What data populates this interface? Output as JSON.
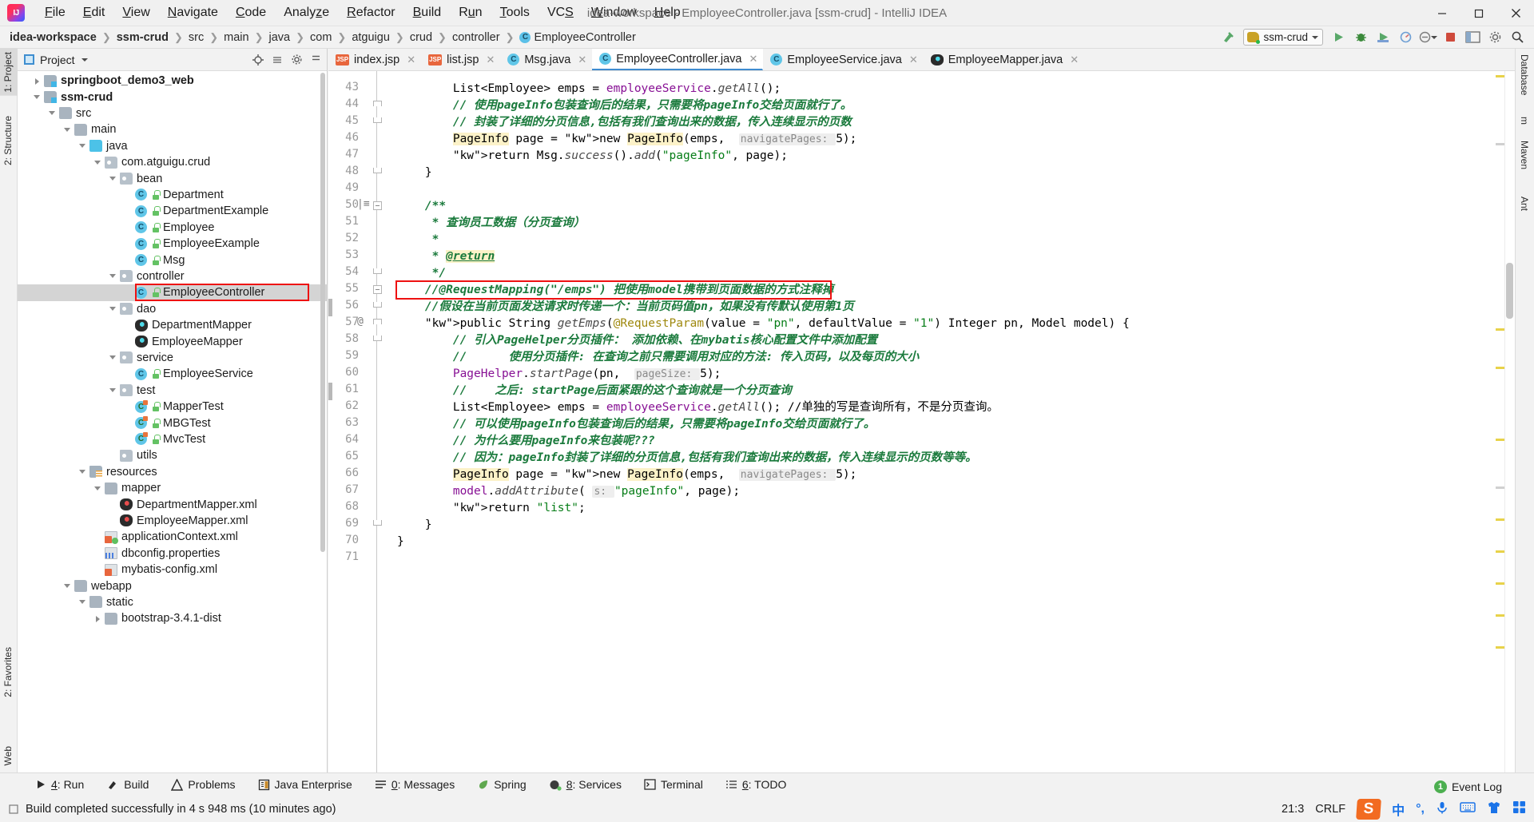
{
  "window": {
    "title": "idea-workspace - EmployeeController.java [ssm-crud] - IntelliJ IDEA",
    "app_icon": "intellij-idea-logo",
    "minimize": "–",
    "maximize": "❐",
    "close": "✕"
  },
  "menu": [
    {
      "label": "File",
      "mnemonic": "F"
    },
    {
      "label": "Edit",
      "mnemonic": "E"
    },
    {
      "label": "View",
      "mnemonic": "V"
    },
    {
      "label": "Navigate",
      "mnemonic": "N"
    },
    {
      "label": "Code",
      "mnemonic": "C"
    },
    {
      "label": "Analyze",
      "mnemonic": "z"
    },
    {
      "label": "Refactor",
      "mnemonic": "R"
    },
    {
      "label": "Build",
      "mnemonic": "B"
    },
    {
      "label": "Run",
      "mnemonic": "u"
    },
    {
      "label": "Tools",
      "mnemonic": "T"
    },
    {
      "label": "VCS",
      "mnemonic": "S"
    },
    {
      "label": "Window",
      "mnemonic": "W"
    },
    {
      "label": "Help",
      "mnemonic": "H"
    }
  ],
  "breadcrumb": {
    "items": [
      "idea-workspace",
      "ssm-crud",
      "src",
      "main",
      "java",
      "com",
      "atguigu",
      "crud",
      "controller"
    ],
    "last": "EmployeeController",
    "last_icon": "class-icon"
  },
  "toolbar": {
    "run_config": "ssm-crud",
    "icons": [
      "build-hammer-icon",
      "run-icon",
      "debug-icon",
      "run-coverage-icon",
      "profile-icon",
      "attach-debugger-icon",
      "stop-icon",
      "layout-icon",
      "settings-icon",
      "search-everywhere-icon"
    ]
  },
  "left_strip": [
    {
      "label": "1: Project",
      "selected": true
    },
    {
      "label": "2: Structure",
      "selected": false
    },
    {
      "label": "2: Favorites",
      "selected": false
    },
    {
      "label": "Web",
      "selected": false
    }
  ],
  "right_strip": [
    "Database",
    "m",
    "Maven",
    "Ant"
  ],
  "project_panel": {
    "title": "Project",
    "header_icons": [
      "locate-icon",
      "collapse-all-icon",
      "settings-icon",
      "hide-icon"
    ],
    "tree": [
      {
        "label": "springboot_demo3_web",
        "depth": 1,
        "arrow": "right",
        "icon": "module",
        "bold": true,
        "lock": false
      },
      {
        "label": "ssm-crud",
        "depth": 1,
        "arrow": "down",
        "icon": "module",
        "bold": true,
        "lock": false
      },
      {
        "label": "src",
        "depth": 2,
        "arrow": "down",
        "icon": "folder",
        "bold": false,
        "lock": false
      },
      {
        "label": "main",
        "depth": 3,
        "arrow": "down",
        "icon": "folder",
        "bold": false,
        "lock": false
      },
      {
        "label": "java",
        "depth": 4,
        "arrow": "down",
        "icon": "folderblue",
        "bold": false,
        "lock": false
      },
      {
        "label": "com.atguigu.crud",
        "depth": 5,
        "arrow": "down",
        "icon": "folderpkg",
        "bold": false,
        "lock": false
      },
      {
        "label": "bean",
        "depth": 6,
        "arrow": "down",
        "icon": "folderpkg",
        "bold": false,
        "lock": false
      },
      {
        "label": "Department",
        "depth": 7,
        "arrow": "none",
        "icon": "cls",
        "bold": false,
        "lock": true
      },
      {
        "label": "DepartmentExample",
        "depth": 7,
        "arrow": "none",
        "icon": "cls",
        "bold": false,
        "lock": true
      },
      {
        "label": "Employee",
        "depth": 7,
        "arrow": "none",
        "icon": "cls",
        "bold": false,
        "lock": true
      },
      {
        "label": "EmployeeExample",
        "depth": 7,
        "arrow": "none",
        "icon": "cls",
        "bold": false,
        "lock": true
      },
      {
        "label": "Msg",
        "depth": 7,
        "arrow": "none",
        "icon": "cls",
        "bold": false,
        "lock": true
      },
      {
        "label": "controller",
        "depth": 6,
        "arrow": "down",
        "icon": "folderpkg",
        "bold": false,
        "lock": false
      },
      {
        "label": "EmployeeController",
        "depth": 7,
        "arrow": "none",
        "icon": "cls",
        "bold": false,
        "lock": true,
        "selected": true,
        "annotated": true
      },
      {
        "label": "dao",
        "depth": 6,
        "arrow": "down",
        "icon": "folderpkg",
        "bold": false,
        "lock": false
      },
      {
        "label": "DepartmentMapper",
        "depth": 7,
        "arrow": "none",
        "icon": "mapper",
        "bold": false,
        "lock": false
      },
      {
        "label": "EmployeeMapper",
        "depth": 7,
        "arrow": "none",
        "icon": "mapper",
        "bold": false,
        "lock": false
      },
      {
        "label": "service",
        "depth": 6,
        "arrow": "down",
        "icon": "folderpkg",
        "bold": false,
        "lock": false
      },
      {
        "label": "EmployeeService",
        "depth": 7,
        "arrow": "none",
        "icon": "cls",
        "bold": false,
        "lock": true
      },
      {
        "label": "test",
        "depth": 6,
        "arrow": "down",
        "icon": "folderpkg",
        "bold": false,
        "lock": false
      },
      {
        "label": "MapperTest",
        "depth": 7,
        "arrow": "none",
        "icon": "clstest",
        "bold": false,
        "lock": true
      },
      {
        "label": "MBGTest",
        "depth": 7,
        "arrow": "none",
        "icon": "clstest",
        "bold": false,
        "lock": true
      },
      {
        "label": "MvcTest",
        "depth": 7,
        "arrow": "none",
        "icon": "clstest",
        "bold": false,
        "lock": true
      },
      {
        "label": "utils",
        "depth": 6,
        "arrow": "none",
        "icon": "folderpkg",
        "bold": false,
        "lock": false
      },
      {
        "label": "resources",
        "depth": 4,
        "arrow": "down",
        "icon": "resources",
        "bold": false,
        "lock": false
      },
      {
        "label": "mapper",
        "depth": 5,
        "arrow": "down",
        "icon": "folder",
        "bold": false,
        "lock": false
      },
      {
        "label": "DepartmentMapper.xml",
        "depth": 6,
        "arrow": "none",
        "icon": "mapperxml",
        "bold": false,
        "lock": false
      },
      {
        "label": "EmployeeMapper.xml",
        "depth": 6,
        "arrow": "none",
        "icon": "mapperxml",
        "bold": false,
        "lock": false
      },
      {
        "label": "applicationContext.xml",
        "depth": 5,
        "arrow": "none",
        "icon": "springfile",
        "bold": false,
        "lock": false
      },
      {
        "label": "dbconfig.properties",
        "depth": 5,
        "arrow": "none",
        "icon": "props",
        "bold": false,
        "lock": false
      },
      {
        "label": "mybatis-config.xml",
        "depth": 5,
        "arrow": "none",
        "icon": "xmlfile",
        "bold": false,
        "lock": false
      },
      {
        "label": "webapp",
        "depth": 3,
        "arrow": "down",
        "icon": "folder",
        "bold": false,
        "lock": false
      },
      {
        "label": "static",
        "depth": 4,
        "arrow": "down",
        "icon": "folder",
        "bold": false,
        "lock": false
      },
      {
        "label": "bootstrap-3.4.1-dist",
        "depth": 5,
        "arrow": "right",
        "icon": "folder",
        "bold": false,
        "lock": false
      }
    ]
  },
  "editor": {
    "tabs": [
      {
        "label": "index.jsp",
        "icon": "jsp-icon",
        "active": false,
        "closable": true
      },
      {
        "label": "list.jsp",
        "icon": "jsp-icon",
        "active": false,
        "closable": true
      },
      {
        "label": "Msg.java",
        "icon": "class-icon",
        "active": false,
        "closable": true
      },
      {
        "label": "EmployeeController.java",
        "icon": "class-icon",
        "active": true,
        "closable": true
      },
      {
        "label": "EmployeeService.java",
        "icon": "class-icon",
        "active": false,
        "closable": true
      },
      {
        "label": "EmployeeMapper.java",
        "icon": "mapper-icon",
        "active": false,
        "closable": true
      }
    ],
    "first_line": 42,
    "lines": [
      {
        "n": 43,
        "text": "        List<Employee> emps = employeeService.getAll();"
      },
      {
        "n": 44,
        "text": "        // 使用pageInfo包装查询后的结果，只需要将pageInfo交给页面就行了。"
      },
      {
        "n": 45,
        "text": "        // 封装了详细的分页信息,包括有我们查询出来的数据，传入连续显示的页数"
      },
      {
        "n": 46,
        "text": "        PageInfo page = new PageInfo(emps,  navigatePages: 5);"
      },
      {
        "n": 47,
        "text": "        return Msg.success().add(\"pageInfo\", page);"
      },
      {
        "n": 48,
        "text": "    }"
      },
      {
        "n": 49,
        "text": ""
      },
      {
        "n": 50,
        "text": "    /**"
      },
      {
        "n": 51,
        "text": "     * 查询员工数据（分页查询）"
      },
      {
        "n": 52,
        "text": "     *"
      },
      {
        "n": 53,
        "text": "     * @return"
      },
      {
        "n": 54,
        "text": "     */"
      },
      {
        "n": 55,
        "text": "    //@RequestMapping(\"/emps\") 把使用model携带到页面数据的方式注释掉"
      },
      {
        "n": 56,
        "text": "    //假设在当前页面发送请求时传递一个：当前页码值pn，如果没有传默认使用第1页"
      },
      {
        "n": 57,
        "text": "    public String getEmps(@RequestParam(value = \"pn\", defaultValue = \"1\") Integer pn, Model model) {"
      },
      {
        "n": 58,
        "text": "        // 引入PageHelper分页插件： 添加依赖、在mybatis核心配置文件中添加配置"
      },
      {
        "n": 59,
        "text": "        //      使用分页插件: 在查询之前只需要调用对应的方法: 传入页码，以及每页的大小"
      },
      {
        "n": 60,
        "text": "        PageHelper.startPage(pn,  pageSize: 5);"
      },
      {
        "n": 61,
        "text": "        //    之后: startPage后面紧跟的这个查询就是一个分页查询"
      },
      {
        "n": 62,
        "text": "        List<Employee> emps = employeeService.getAll(); //单独的写是查询所有，不是分页查询。"
      },
      {
        "n": 63,
        "text": "        // 可以使用pageInfo包装查询后的结果，只需要将pageInfo交给页面就行了。"
      },
      {
        "n": 64,
        "text": "        // 为什么要用pageInfo来包装呢???"
      },
      {
        "n": 65,
        "text": "        // 因为：pageInfo封装了详细的分页信息,包括有我们查询出来的数据，传入连续显示的页数等等。"
      },
      {
        "n": 66,
        "text": "        PageInfo page = new PageInfo(emps,  navigatePages: 5);"
      },
      {
        "n": 67,
        "text": "        model.addAttribute( s: \"pageInfo\", page);"
      },
      {
        "n": 68,
        "text": "        return \"list\";"
      },
      {
        "n": 69,
        "text": "    }"
      },
      {
        "n": 70,
        "text": "}"
      },
      {
        "n": 71,
        "text": ""
      }
    ],
    "annotation_line": 55,
    "annotation_color": "#ee1111"
  },
  "bottom_tools": [
    {
      "label": "4: Run",
      "mnemonic": "4",
      "icon": "run-icon"
    },
    {
      "label": "Build",
      "mnemonic": "",
      "icon": "build-hammer-icon"
    },
    {
      "label": "Problems",
      "mnemonic": "",
      "icon": "warning-icon"
    },
    {
      "label": "Java Enterprise",
      "mnemonic": "",
      "icon": "java-enterprise-icon"
    },
    {
      "label": "0: Messages",
      "mnemonic": "0",
      "icon": "messages-icon"
    },
    {
      "label": "Spring",
      "mnemonic": "",
      "icon": "spring-leaf-icon"
    },
    {
      "label": "8: Services",
      "mnemonic": "8",
      "icon": "services-icon"
    },
    {
      "label": "Terminal",
      "mnemonic": "",
      "icon": "terminal-icon"
    },
    {
      "label": "6: TODO",
      "mnemonic": "6",
      "icon": "todo-icon"
    }
  ],
  "status": {
    "message": "Build completed successfully in 4 s 948 ms (10 minutes ago)",
    "event_log": "Event Log",
    "event_log_count": "1",
    "caret": "21:3",
    "line_separator": "CRLF",
    "ime_logo": "S",
    "ime_lang": "中",
    "tray_icons": [
      "ime-punctuation-icon",
      "ime-voice-icon",
      "ime-keyboard-icon",
      "ime-skin-icon",
      "ime-apps-icon"
    ]
  },
  "colors": {
    "accent": "#3f8cd1",
    "annotation_red": "#ee1111",
    "comment_green": "#1a7a3c",
    "keyword_blue": "#0033b3",
    "string_green": "#067d17",
    "selection_gray": "#d4d4d4"
  }
}
